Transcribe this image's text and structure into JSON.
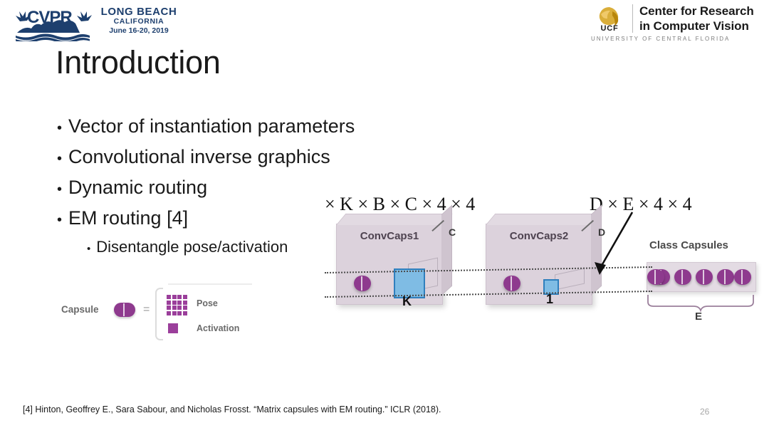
{
  "header": {
    "cvpr": {
      "mark": "cvpr-palm-logo-icon",
      "line1": "LONG BEACH",
      "line2": "CALIFORNIA",
      "line3": "June 16-20, 2019",
      "color": "#1d3f6e"
    },
    "ucf": {
      "mark": "ucf-pegasus-icon",
      "abbrev": "UCF",
      "title_line1": "Center for Research",
      "title_line2": "in Computer Vision",
      "subtitle": "UNIVERSITY OF CENTRAL FLORIDA",
      "color": "#1a1a1a",
      "mark_color": "#d4a017"
    }
  },
  "slide": {
    "title": "Introduction",
    "bullets": [
      {
        "level": 0,
        "marker": "•",
        "text": "Vector of instantiation parameters"
      },
      {
        "level": 0,
        "marker": "•",
        "text": "Convolutional inverse graphics"
      },
      {
        "level": 0,
        "marker": "•",
        "text": "Dynamic routing"
      },
      {
        "level": 0,
        "marker": "•",
        "text": "EM routing [4]"
      },
      {
        "level": 1,
        "marker": "•",
        "text": "Disentangle pose/activation"
      }
    ]
  },
  "capsule_legend": {
    "label": "Capsule",
    "capsule_glyph": "capsule-pill-icon",
    "equals": "=",
    "brace": "left-curly-brace",
    "pose_label": "Pose",
    "pose_glyph": "pose-4x4-matrix-icon",
    "activation_label": "Activation",
    "activation_glyph": "activation-square-icon",
    "accent_color": "#9b3f9b"
  },
  "architecture": {
    "math_left": {
      "prefix": "× ",
      "terms": "K × B × C × 4 × 4"
    },
    "math_left_full": "× K × B × C × 4 × 4",
    "math_right_full": "D × E × 4 × 4",
    "boxes": [
      {
        "name": "ConvCaps1",
        "depth_label": "C",
        "kernel_label": "K"
      },
      {
        "name": "ConvCaps2",
        "depth_label": "D",
        "kernel_label": "1"
      }
    ],
    "class_capsules": {
      "title": "Class Capsules",
      "count": 5,
      "brace_label": "E"
    },
    "colors": {
      "box_fill": "#dcd2dc",
      "capsule_purple": "#8e3a8e",
      "kernel_blue": "#7fbce4",
      "kernel_border": "#2f7fbd"
    }
  },
  "footer": {
    "citation": "[4] Hinton, Geoffrey E., Sara Sabour, and Nicholas Frosst. “Matrix capsules with EM routing.” ICLR (2018).",
    "page_number": "26"
  }
}
